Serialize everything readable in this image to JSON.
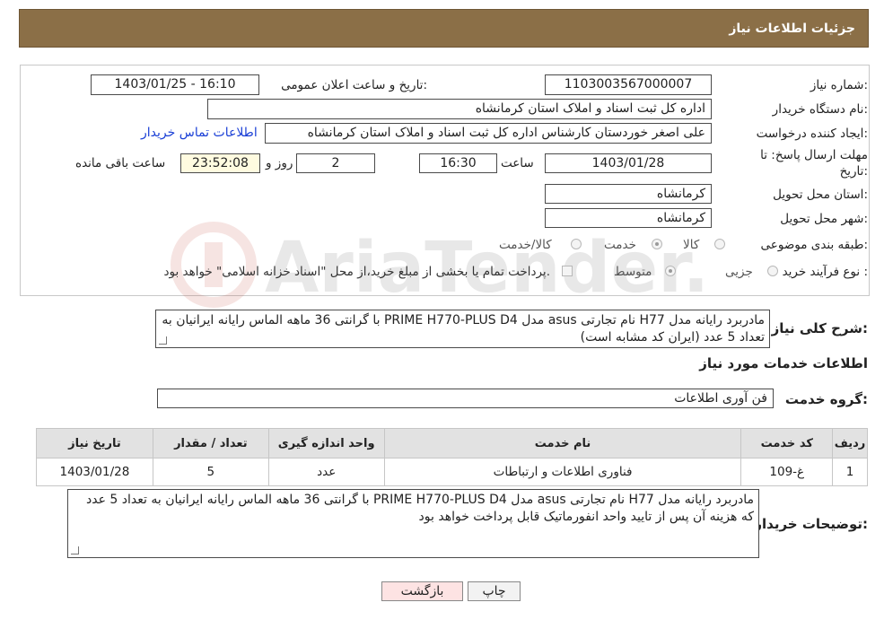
{
  "header": {
    "title": "جزئیات اطلاعات نیاز"
  },
  "form": {
    "need_number": {
      "label": "شماره نیاز:",
      "value": "1103003567000007"
    },
    "announce_datetime": {
      "label": "تاریخ و ساعت اعلان عمومی:",
      "value": "1403/01/25 - 16:10"
    },
    "buyer_org": {
      "label": "نام دستگاه خریدار:",
      "value": "اداره کل ثبت اسناد و املاک استان کرمانشاه"
    },
    "requester": {
      "label": "ایجاد کننده درخواست:",
      "value": "علی اصغر خوردستان کارشناس اداره کل ثبت اسناد و املاک استان کرمانشاه",
      "contact_link": "اطلاعات تماس خریدار"
    },
    "deadline": {
      "label_line1": "مهلت ارسال پاسخ: تا",
      "label_line2": "تاریخ:",
      "date": "1403/01/28",
      "time_label": "ساعت",
      "time": "16:30",
      "days": "2",
      "days_label": "روز و",
      "remaining": "23:52:08",
      "remaining_label": "ساعت باقی مانده"
    },
    "province": {
      "label": "استان محل تحویل:",
      "value": "کرمانشاه"
    },
    "city": {
      "label": "شهر محل تحویل:",
      "value": "کرمانشاه"
    },
    "category": {
      "label": "طبقه بندی موضوعی:",
      "options": [
        "کالا",
        "خدمت",
        "کالا/خدمت"
      ],
      "selected": "خدمت"
    },
    "purchase_type": {
      "label": "نوع فرآیند خرید :",
      "options": [
        "جزیی",
        "متوسط"
      ],
      "selected": "متوسط",
      "note": "پرداخت تمام یا بخشی از مبلغ خرید،از محل \"اسناد خزانه اسلامی\" خواهد بود."
    }
  },
  "summary": {
    "label": "شرح کلی نیاز:",
    "text": "مادربرد رایانه مدل H77 نام تجارتی asus مدل PRIME H770-PLUS D4 با گرانتی 36 ماهه الماس رایانه ایرانیان به تعداد 5 عدد (ایران کد مشابه است)"
  },
  "services": {
    "section_title": "اطلاعات خدمات مورد نیاز",
    "group_label": "گروه خدمت:",
    "group_value": "فن آوری اطلاعات",
    "columns": [
      "ردیف",
      "کد خدمت",
      "نام خدمت",
      "واحد اندازه گیری",
      "تعداد / مقدار",
      "تاریخ نیاز"
    ],
    "rows": [
      [
        "1",
        "غ-109",
        "فناوری اطلاعات و ارتباطات",
        "عدد",
        "5",
        "1403/01/28"
      ]
    ]
  },
  "buyer_notes": {
    "label": "توضیحات خریدار:",
    "text": "مادربرد رایانه مدل H77 نام تجارتی asus مدل PRIME H770-PLUS D4 با گرانتی 36 ماهه الماس رایانه ایرانیان به تعداد 5 عدد که هزینه آن پس از تایید واحد انفورماتیک قابل پرداخت خواهد بود"
  },
  "buttons": {
    "print": "چاپ",
    "back": "بازگشت"
  },
  "watermark": {
    "text": "AriaTender.neT"
  },
  "colors": {
    "header_bg": "#8b6f47",
    "back_button_bg": "#fde3e3",
    "link": "#1a3fd6"
  }
}
